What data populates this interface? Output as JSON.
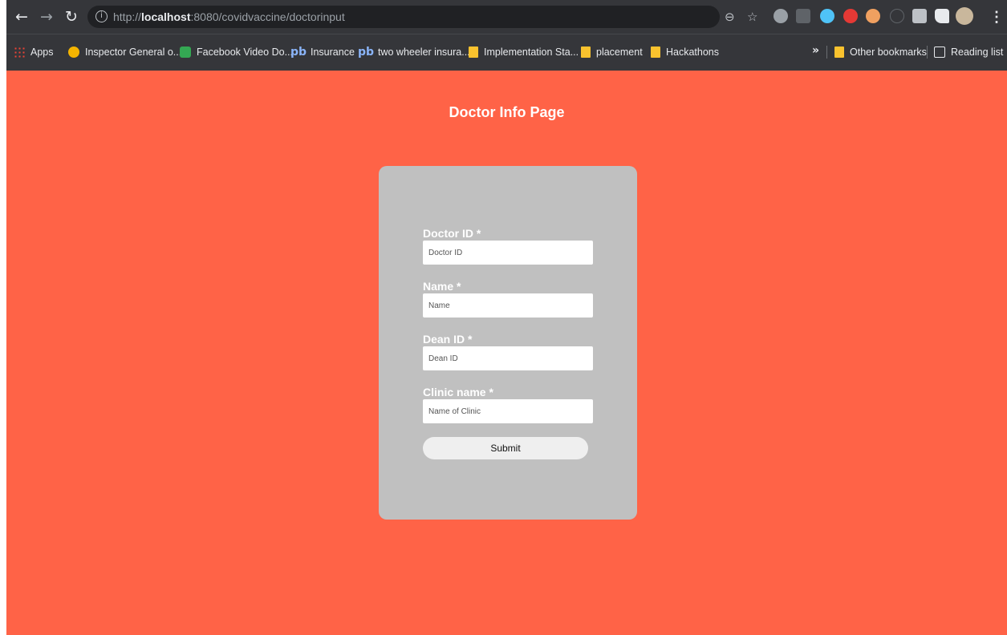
{
  "browser": {
    "url_scheme": "http://",
    "url_host": "localhost",
    "url_rest": ":8080/covidvaccine/doctorinput",
    "menu_dots": "⋮"
  },
  "bookmarks": {
    "apps": "Apps",
    "items": [
      "Inspector General o...",
      "Facebook Video Do...",
      "Insurance",
      "two wheeler insura...",
      "Implementation Sta...",
      "placement",
      "Hackathons"
    ],
    "pb_glyph": "pb",
    "overflow": "»",
    "other": "Other bookmarks",
    "reading_list": "Reading list"
  },
  "page": {
    "title": "Doctor Info Page",
    "background": "#ff6347",
    "card_color": "#c0c0c0"
  },
  "form": {
    "fields": [
      {
        "label": "Doctor ID *",
        "placeholder": "Doctor ID"
      },
      {
        "label": "Name *",
        "placeholder": "Name"
      },
      {
        "label": "Dean ID *",
        "placeholder": "Dean ID"
      },
      {
        "label": "Clinic name *",
        "placeholder": "Name of Clinic"
      }
    ],
    "submit_label": "Submit"
  }
}
